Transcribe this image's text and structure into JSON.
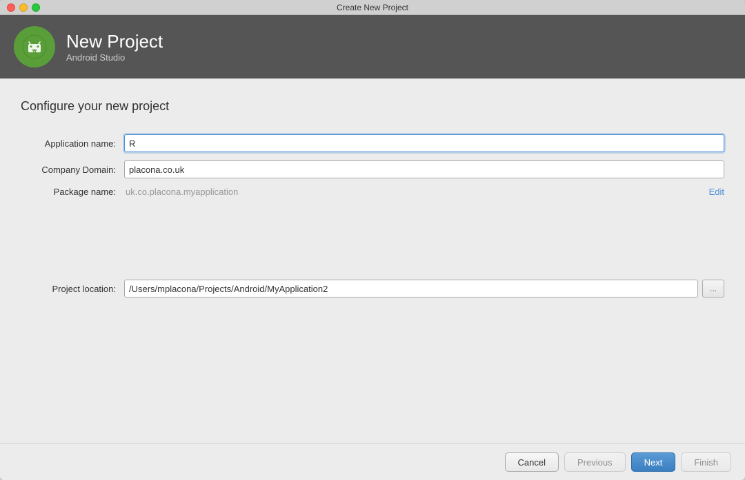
{
  "window": {
    "title": "Create New Project"
  },
  "header": {
    "logo_alt": "Android Studio Logo",
    "title": "New Project",
    "subtitle": "Android Studio"
  },
  "content": {
    "section_title": "Configure your new project",
    "form": {
      "application_name_label": "Application name:",
      "application_name_value": "R",
      "company_domain_label": "Company Domain:",
      "company_domain_value": "placona.co.uk",
      "package_name_label": "Package name:",
      "package_name_value": "uk.co.placona.myapplication",
      "edit_link": "Edit",
      "project_location_label": "Project location:",
      "project_location_value": "/Users/mplacona/Projects/Android/MyApplication2",
      "browse_button_label": "..."
    }
  },
  "footer": {
    "cancel_label": "Cancel",
    "previous_label": "Previous",
    "next_label": "Next",
    "finish_label": "Finish"
  }
}
